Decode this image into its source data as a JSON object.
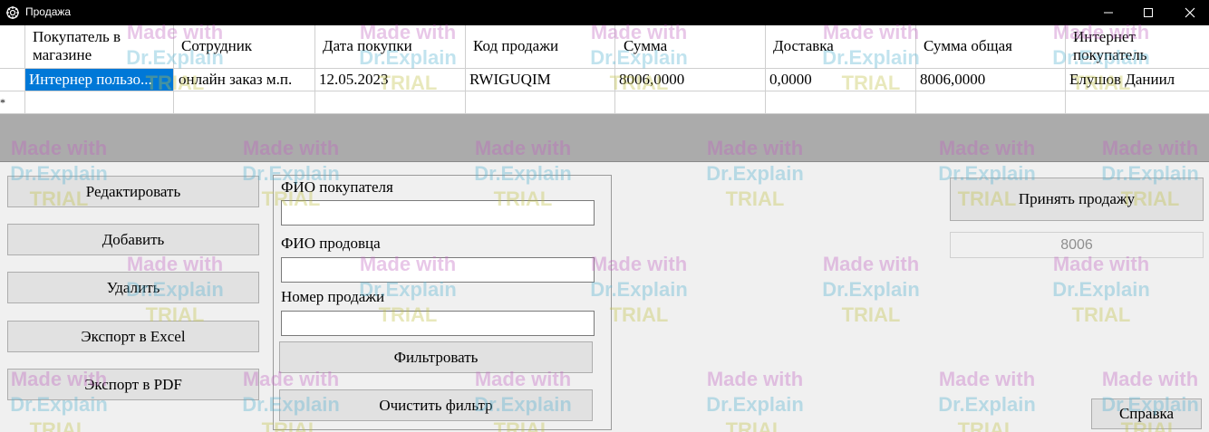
{
  "window": {
    "title": "Продажа",
    "icons": {
      "app": "gear-icon",
      "minimize": "minimize-icon",
      "maximize": "maximize-icon",
      "close": "close-icon"
    }
  },
  "grid": {
    "columns": [
      "Покупатель в магазине",
      "Сотрудник",
      "Дата покупки",
      "Код продажи",
      "Сумма",
      "Доставка",
      "Сумма общая",
      "Интернет покупатель"
    ],
    "rows": [
      [
        "Интернер пользо...",
        "онлайн заказ м.п.",
        "12.05.2023",
        "RWIGUQIM",
        "8006,0000",
        "0,0000",
        "8006,0000",
        "Елушов Даниил"
      ]
    ],
    "new_row_marker": "*",
    "selected_color": "#0078d7"
  },
  "buttons": {
    "edit": "Редактировать",
    "add": "Добавить",
    "delete": "Удалить",
    "export_excel": "Экспорт в Excel",
    "export_pdf": "Экспорт в PDF",
    "filter": "Фильтровать",
    "clear_filter": "Очистить фильтр",
    "accept_sale": "Принять продажу",
    "help": "Справка"
  },
  "filter": {
    "buyer_label": "ФИО покупателя",
    "buyer_value": "",
    "seller_label": "ФИО продовца",
    "seller_value": "",
    "number_label": "Номер продажи",
    "number_value": ""
  },
  "total_display": "8006",
  "watermark": {
    "line1": "Made with",
    "line2": "Dr.Explain",
    "line3": "TRIAL"
  }
}
